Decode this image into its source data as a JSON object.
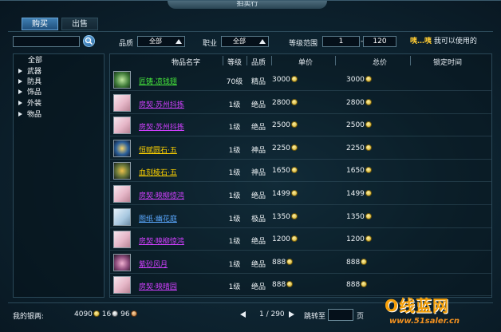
{
  "window": {
    "title": "拍卖行"
  },
  "tabs": [
    {
      "label": "购买",
      "active": true
    },
    {
      "label": "出售",
      "active": false
    }
  ],
  "filters": {
    "search_value": "",
    "quality_label": "品质",
    "quality_value": "全部",
    "class_label": "职业",
    "class_value": "全部",
    "level_range_label": "等级范围",
    "level_min": "1",
    "level_sep": "-",
    "level_max": "120",
    "usable_emoji": "咦…咦",
    "usable_label": "我可以使用的"
  },
  "sidebar": {
    "items": [
      {
        "label": "全部",
        "expandable": false
      },
      {
        "label": "武器",
        "expandable": true
      },
      {
        "label": "防具",
        "expandable": true
      },
      {
        "label": "饰品",
        "expandable": true
      },
      {
        "label": "外装",
        "expandable": true
      },
      {
        "label": "物品",
        "expandable": true
      }
    ]
  },
  "table": {
    "headers": [
      "物品名字",
      "等级",
      "品质",
      "单价",
      "总价",
      "锁定时间"
    ],
    "rows": [
      {
        "name": "匠铸·凉钱翅",
        "name_color": "#46e83c",
        "level": "70级",
        "quality": "精品",
        "unit_price": "3000",
        "total": "3000",
        "icon": "green-gourd-icon"
      },
      {
        "name": "房契·苏州抖拣",
        "name_color": "#d040ff",
        "level": "1级",
        "quality": "绝品",
        "unit_price": "2800",
        "total": "2800",
        "icon": "deed-scroll-icon"
      },
      {
        "name": "房契·苏州抖拣",
        "name_color": "#d040ff",
        "level": "1级",
        "quality": "绝品",
        "unit_price": "2500",
        "total": "2500",
        "icon": "deed-scroll-icon"
      },
      {
        "name": "恒赋圆石·五",
        "name_color": "#ffd200",
        "level": "1级",
        "quality": "神品",
        "unit_price": "2250",
        "total": "2250",
        "icon": "gem-stone-icon"
      },
      {
        "name": "血刻棱石·五",
        "name_color": "#ffd200",
        "level": "1级",
        "quality": "神品",
        "unit_price": "1650",
        "total": "1650",
        "icon": "shield-stone-icon"
      },
      {
        "name": "房契·映柳惊鸿",
        "name_color": "#d040ff",
        "level": "1级",
        "quality": "绝品",
        "unit_price": "1499",
        "total": "1499",
        "icon": "deed-scroll-icon"
      },
      {
        "name": "图纸·幽花庭",
        "name_color": "#5aa8ff",
        "level": "1级",
        "quality": "极品",
        "unit_price": "1350",
        "total": "1350",
        "icon": "blueprint-icon"
      },
      {
        "name": "房契·映柳惊鸿",
        "name_color": "#d040ff",
        "level": "1级",
        "quality": "绝品",
        "unit_price": "1200",
        "total": "1200",
        "icon": "deed-scroll-icon"
      },
      {
        "name": "紫砂风月",
        "name_color": "#d040ff",
        "level": "1级",
        "quality": "绝品",
        "unit_price": "888",
        "total": "888",
        "icon": "teapot-icon"
      },
      {
        "name": "房契·映晴园",
        "name_color": "#d040ff",
        "level": "1级",
        "quality": "绝品",
        "unit_price": "888",
        "total": "888",
        "icon": "deed-scroll-icon"
      }
    ]
  },
  "footer": {
    "money_label": "我的银两:",
    "gold": "4090",
    "silver": "16",
    "copper": "96",
    "page_info": "1 / 290",
    "jump_label": "跳转至",
    "jump_suffix": "页"
  },
  "watermark": {
    "logo": "O线蓝网",
    "url": "www.51saler.cn"
  }
}
